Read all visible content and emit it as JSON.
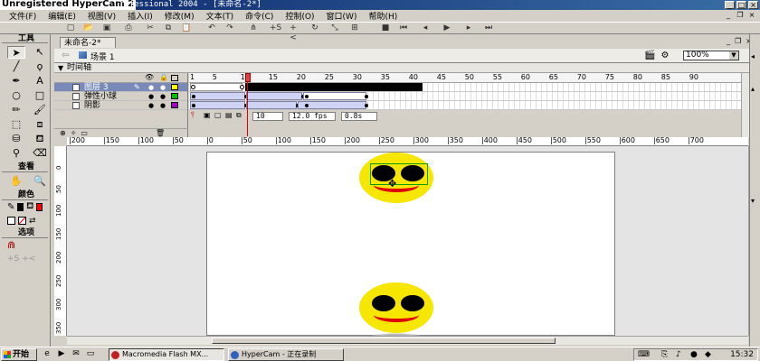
{
  "window": {
    "watermark": "Unregistered HyperCam 2",
    "title": "rofessional 2004 - [未命名-2*]"
  },
  "menu": [
    "文件(F)",
    "编辑(E)",
    "视图(V)",
    "插入(I)",
    "修改(M)",
    "文本(T)",
    "命令(C)",
    "控制(O)",
    "窗口(W)",
    "帮助(H)"
  ],
  "tools": {
    "header": "工具",
    "view_label": "查看",
    "colors_label": "颜色",
    "options_label": "选项",
    "stroke_color": "#000000",
    "fill_color": "#ff0000"
  },
  "document": {
    "tab": "未命名-2*",
    "scene": "场景 1",
    "zoom": "100%"
  },
  "timeline": {
    "header": "时间轴",
    "layers": [
      {
        "name": "图层 3",
        "selected": true,
        "outline_color": "#ffff00"
      },
      {
        "name": "弹性小球",
        "selected": false,
        "outline_color": "#00c000"
      },
      {
        "name": "阴影",
        "selected": false,
        "outline_color": "#a000c0"
      }
    ],
    "frame_numbers": [
      "1",
      "5",
      "10",
      "15",
      "20",
      "25",
      "30",
      "35",
      "40",
      "45",
      "50",
      "55",
      "60",
      "65",
      "70",
      "75",
      "80",
      "85",
      "90"
    ],
    "current_frame": "10",
    "fps": "12.0 fps",
    "elapsed": "0.8s"
  },
  "rulers": {
    "horizontal": [
      "200",
      "150",
      "100",
      "50",
      "0",
      "50",
      "100",
      "150",
      "200",
      "250",
      "300",
      "350",
      "400",
      "450",
      "500",
      "550",
      "600",
      "650",
      "700"
    ],
    "vertical": [
      "0",
      "50",
      "100",
      "150",
      "200",
      "250",
      "300",
      "350"
    ]
  },
  "taskbar": {
    "start": "开始",
    "tasks": [
      {
        "label": "Macromedia Flash MX...",
        "active": true
      },
      {
        "label": "HyperCam - 正在录制",
        "active": false
      }
    ],
    "clock": "15:32"
  }
}
